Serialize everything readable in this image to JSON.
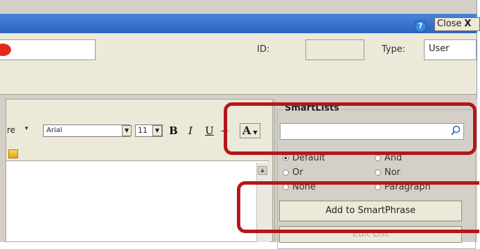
{
  "titlebar": {
    "help_icon": "?",
    "close_label": "Close",
    "close_x": "X"
  },
  "header": {
    "id_label": "ID:",
    "id_value": "",
    "type_label": "Type:",
    "type_value": "User"
  },
  "toolbar": {
    "style_label_fragment": "re",
    "style_dropdown_arrow": "▾",
    "font_name": "Arial",
    "font_size": "11",
    "bold": "B",
    "italic": "I",
    "underline": "U",
    "strike": "+",
    "text_color": "A"
  },
  "smartlists": {
    "title": "SmartLists",
    "search_value": "",
    "radios": [
      {
        "label": "Default",
        "checked": true
      },
      {
        "label": "And",
        "checked": false
      },
      {
        "label": "Or",
        "checked": false
      },
      {
        "label": "Nor",
        "checked": false
      },
      {
        "label": "None",
        "checked": false
      },
      {
        "label": "Paragraph",
        "checked": false
      }
    ],
    "add_button": "Add to SmartPhrase",
    "edit_button": "Edit List"
  },
  "colors": {
    "titlebar": "#2f63c1",
    "highlight": "#b5151a",
    "panel": "#d4d0c8"
  }
}
